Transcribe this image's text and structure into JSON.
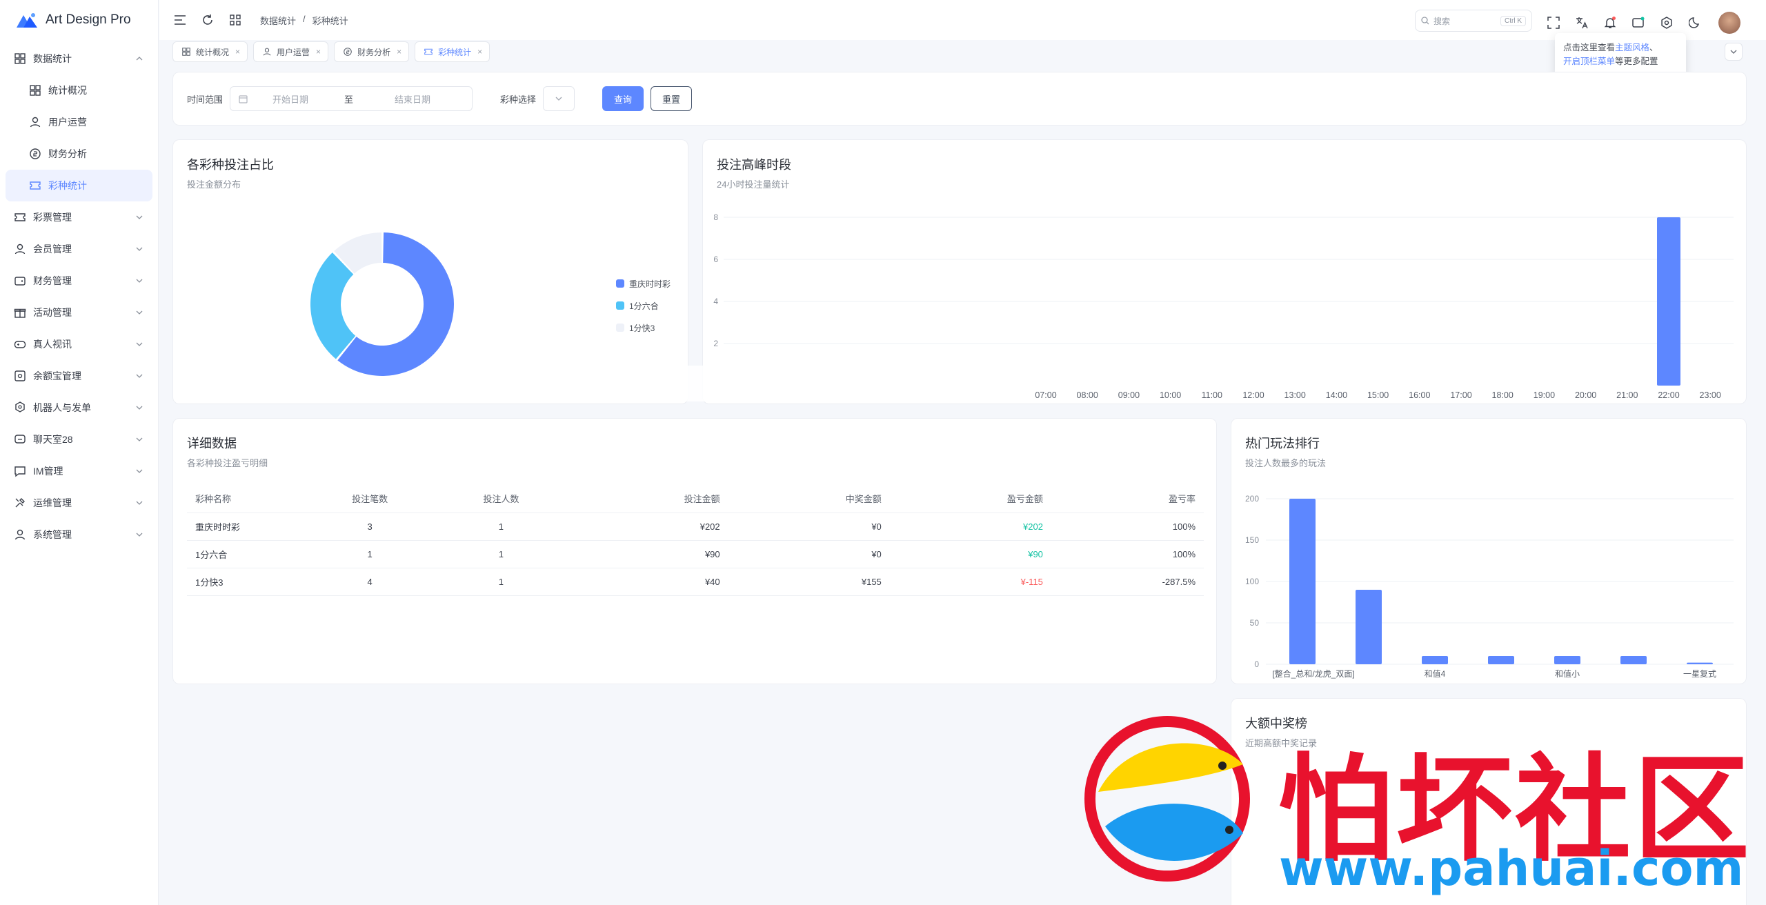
{
  "app": {
    "title": "Art Design Pro"
  },
  "sidebar": {
    "items": [
      {
        "label": "数据统计",
        "icon": "bar-chart-icon",
        "expanded": true
      },
      {
        "label": "统计概况",
        "icon": "grid-icon",
        "sub": true
      },
      {
        "label": "用户运营",
        "icon": "user-icon",
        "sub": true
      },
      {
        "label": "财务分析",
        "icon": "coin-icon",
        "sub": true
      },
      {
        "label": "彩种统计",
        "icon": "ticket-icon",
        "sub": true,
        "active": true
      },
      {
        "label": "彩票管理",
        "icon": "ticket-icon"
      },
      {
        "label": "会员管理",
        "icon": "user-icon"
      },
      {
        "label": "财务管理",
        "icon": "wallet-icon"
      },
      {
        "label": "活动管理",
        "icon": "gift-icon"
      },
      {
        "label": "真人视讯",
        "icon": "gamepad-icon"
      },
      {
        "label": "余额宝管理",
        "icon": "safe-icon"
      },
      {
        "label": "机器人与发单",
        "icon": "robot-icon"
      },
      {
        "label": "聊天室28",
        "icon": "chat-icon"
      },
      {
        "label": "IM管理",
        "icon": "message-icon"
      },
      {
        "label": "运维管理",
        "icon": "tools-icon"
      },
      {
        "label": "系统管理",
        "icon": "user-icon"
      }
    ]
  },
  "topbar": {
    "breadcrumb": [
      "数据统计",
      "/",
      "彩种统计"
    ],
    "search_placeholder": "搜索",
    "search_shortcut": "Ctrl K"
  },
  "tabs": [
    {
      "label": "统计概况",
      "icon": "grid-icon"
    },
    {
      "label": "用户运营",
      "icon": "user-icon"
    },
    {
      "label": "财务分析",
      "icon": "coin-icon"
    },
    {
      "label": "彩种统计",
      "icon": "ticket-icon",
      "active": true
    }
  ],
  "tooltip": {
    "line1_a": "点击这里查看",
    "line1_b": "主题风格",
    "line1_c": "、",
    "line2_a": "开启顶栏菜单",
    "line2_b": "等更多配置"
  },
  "filter": {
    "time_label": "时间范围",
    "start_placeholder": "开始日期",
    "separator": "至",
    "end_placeholder": "结束日期",
    "lottery_label": "彩种选择",
    "query_button": "查询",
    "reset_button": "重置"
  },
  "pie_card": {
    "title": "各彩种投注占比",
    "subtitle": "投注金额分布"
  },
  "peak_card": {
    "title": "投注高峰时段",
    "subtitle": "24小时投注量统计"
  },
  "detail_card": {
    "title": "详细数据",
    "subtitle": "各彩种投注盈亏明细",
    "columns": [
      "彩种名称",
      "投注笔数",
      "投注人数",
      "投注金额",
      "中奖金额",
      "盈亏金额",
      "盈亏率"
    ],
    "rows": [
      [
        "重庆时时彩",
        "3",
        "1",
        "¥202",
        "¥0",
        "¥202",
        "100%"
      ],
      [
        "1分六合",
        "1",
        "1",
        "¥90",
        "¥0",
        "¥90",
        "100%"
      ],
      [
        "1分快3",
        "4",
        "1",
        "¥40",
        "¥155",
        "¥-115",
        "-287.5%"
      ]
    ]
  },
  "hot_card": {
    "title": "热门玩法排行",
    "subtitle": "投注人数最多的玩法"
  },
  "big_card": {
    "title": "大额中奖榜",
    "subtitle": "近期高额中奖记录"
  },
  "watermark": {
    "text": "怕坏社区",
    "url": "www.pahuai.com"
  },
  "colors": {
    "primary": "#5d87ff",
    "cyan": "#4fc3f7",
    "light": "#eef1f8",
    "positive": "#13c2a3",
    "negative": "#fa5a5a"
  },
  "chart_data": [
    {
      "type": "pie",
      "categories": [
        "重庆时时彩",
        "1分六合",
        "1分快3"
      ],
      "values": [
        202,
        90,
        40
      ],
      "legend": "right"
    },
    {
      "type": "bar",
      "categories": [
        "07:00",
        "08:00",
        "09:00",
        "10:00",
        "11:00",
        "12:00",
        "13:00",
        "14:00",
        "15:00",
        "16:00",
        "17:00",
        "18:00",
        "19:00",
        "20:00",
        "21:00",
        "22:00",
        "23:00"
      ],
      "values": [
        0,
        0,
        0,
        0,
        0,
        0,
        0,
        0,
        0,
        0,
        0,
        0,
        0,
        0,
        0,
        8,
        0
      ],
      "ylim": [
        0,
        8
      ],
      "yticks": [
        "2",
        "4",
        "6",
        "8"
      ],
      "grid": true
    },
    {
      "type": "bar",
      "categories": [
        "[整合_总和/龙虎_双面]",
        "",
        "和值4",
        "",
        "和值小",
        "",
        "一星复式"
      ],
      "values": [
        200,
        90,
        10,
        10,
        10,
        10,
        2
      ],
      "ylim": [
        0,
        200
      ],
      "yticks": [
        "0",
        "50",
        "100",
        "150",
        "200"
      ],
      "grid": true
    }
  ]
}
